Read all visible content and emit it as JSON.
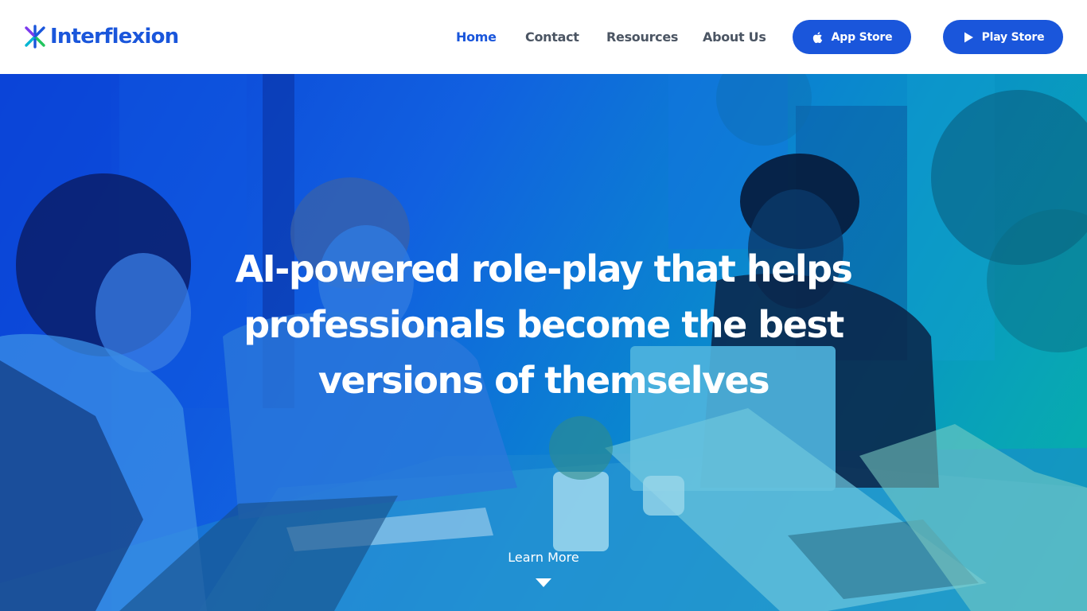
{
  "brand": {
    "name": "Interflexion",
    "color": "#1a56db",
    "logo_icon": "interflexion-logo-icon"
  },
  "nav": {
    "items": [
      {
        "label": "Home",
        "active": true
      },
      {
        "label": "Contact",
        "active": false
      },
      {
        "label": "Resources",
        "active": false
      },
      {
        "label": "About Us",
        "active": false
      }
    ],
    "app_store_label": "App Store",
    "app_store_icon": "apple-icon",
    "play_store_label": "Play Store",
    "play_store_icon": "play-icon"
  },
  "hero": {
    "title": "AI-powered role-play that helps professionals become the best versions of themselves",
    "learn_more_label": "Learn More",
    "learn_more_icon": "caret-down-icon",
    "overlay_colors": [
      "#0a3fd6",
      "#06b2a6"
    ]
  }
}
